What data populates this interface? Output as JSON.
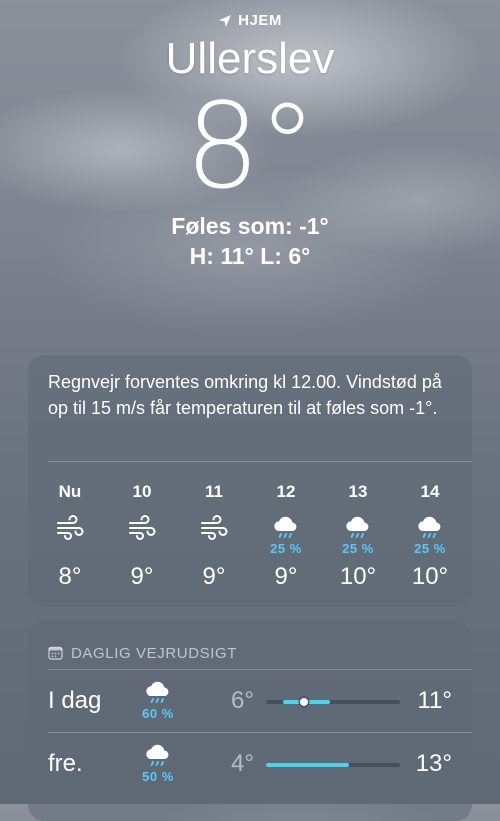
{
  "location": {
    "home_label": "HJEM",
    "city": "Ullerslev"
  },
  "current": {
    "temperature": "8°",
    "feels_like": "Føles som: -1°",
    "high_low": "H: 11°  L: 6°"
  },
  "hourly": {
    "summary": "Regnvejr forventes omkring kl 12.00. Vindstød på op til 15 m/s får temperaturen til at føles som -1°.",
    "items": [
      {
        "time": "Nu",
        "icon": "wind-icon",
        "precip": "",
        "temp": "8°"
      },
      {
        "time": "10",
        "icon": "wind-icon",
        "precip": "",
        "temp": "9°"
      },
      {
        "time": "11",
        "icon": "wind-icon",
        "precip": "",
        "temp": "9°"
      },
      {
        "time": "12",
        "icon": "rain-cloud-icon",
        "precip": "25 %",
        "temp": "9°"
      },
      {
        "time": "13",
        "icon": "rain-cloud-icon",
        "precip": "25 %",
        "temp": "10°"
      },
      {
        "time": "14",
        "icon": "rain-cloud-icon",
        "precip": "25 %",
        "temp": "10°"
      }
    ]
  },
  "daily": {
    "header": "DAGLIG VEJRUDSIGT",
    "days": [
      {
        "name": "I dag",
        "icon": "rain-cloud-icon",
        "precip": "60 %",
        "low": "6°",
        "high": "11°",
        "range_start": 0.13,
        "range_end": 0.48,
        "current_position": 0.28
      },
      {
        "name": "fre.",
        "icon": "rain-cloud-icon",
        "precip": "50 %",
        "low": "4°",
        "high": "13°",
        "range_start": 0.0,
        "range_end": 0.62
      }
    ]
  },
  "colors": {
    "precip_accent": "#5ac8fa",
    "range_bar": "#4fd1e8"
  }
}
